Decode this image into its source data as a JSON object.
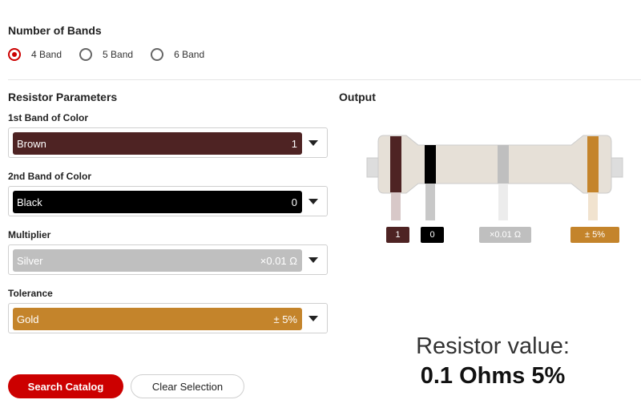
{
  "bands_section": {
    "title": "Number of Bands",
    "options": [
      {
        "label": "4 Band",
        "selected": true
      },
      {
        "label": "5 Band",
        "selected": false
      },
      {
        "label": "6 Band",
        "selected": false
      }
    ]
  },
  "params": {
    "title": "Resistor Parameters",
    "fields": [
      {
        "label": "1st Band of Color",
        "color_name": "Brown",
        "value": "1",
        "color": "#4e2323"
      },
      {
        "label": "2nd Band of Color",
        "color_name": "Black",
        "value": "0",
        "color": "#000000"
      },
      {
        "label": "Multiplier",
        "color_name": "Silver",
        "value": "×0.01 Ω",
        "color": "#bfbfbf"
      },
      {
        "label": "Tolerance",
        "color_name": "Gold",
        "value": "± 5%",
        "color": "#c4842b"
      }
    ]
  },
  "output": {
    "title": "Output",
    "tags": [
      "1",
      "0",
      "×0.01 Ω",
      "± 5%"
    ],
    "result_title": "Resistor value:",
    "result_value": "0.1 Ohms 5%"
  },
  "buttons": {
    "search": "Search Catalog",
    "clear": "Clear Selection"
  },
  "colors": {
    "accent": "#cc0000",
    "resistor_body": "#e6e0d7",
    "lead": "#dddddd"
  }
}
